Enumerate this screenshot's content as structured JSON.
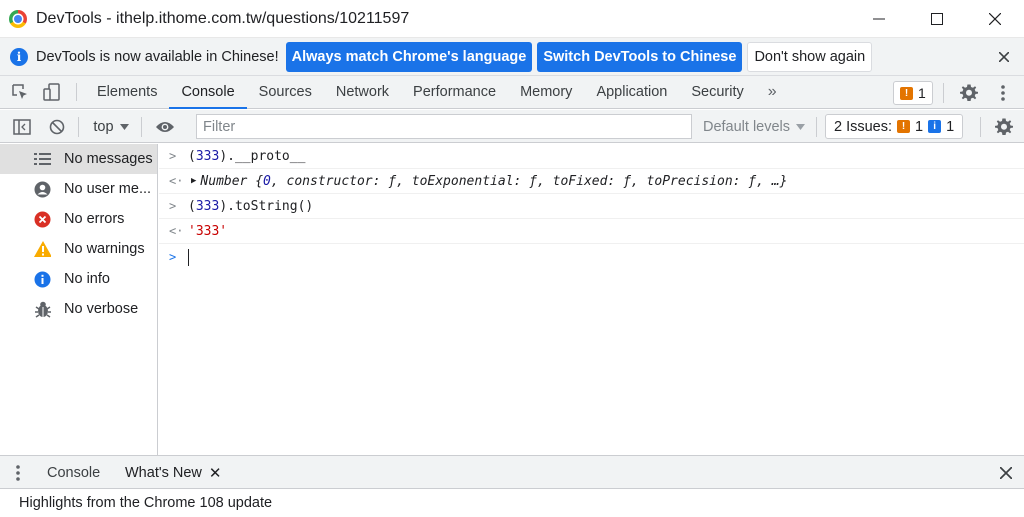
{
  "window": {
    "title": "DevTools - ithelp.ithome.com.tw/questions/10211597",
    "icons": [
      "chrome-logo",
      "minimize-icon",
      "maximize-icon",
      "close-icon"
    ]
  },
  "infobar": {
    "message": "DevTools is now available in Chinese!",
    "btn_match": "Always match Chrome's language",
    "btn_switch": "Switch DevTools to Chinese",
    "btn_dismiss": "Don't show again"
  },
  "tabs": {
    "items": [
      "Elements",
      "Console",
      "Sources",
      "Network",
      "Performance",
      "Memory",
      "Application",
      "Security"
    ],
    "active": "Console",
    "more": "»",
    "issues_count": "1"
  },
  "console_toolbar": {
    "context": "top",
    "filter_placeholder": "Filter",
    "levels": "Default levels",
    "issues_label": "2 Issues:",
    "warn_count": "1",
    "info_count": "1"
  },
  "sidebar": {
    "items": [
      {
        "label": "No messages",
        "icon": "list-icon"
      },
      {
        "label": "No user me...",
        "icon": "user-icon"
      },
      {
        "label": "No errors",
        "icon": "error-icon"
      },
      {
        "label": "No warnings",
        "icon": "warning-icon"
      },
      {
        "label": "No info",
        "icon": "info-icon"
      },
      {
        "label": "No verbose",
        "icon": "bug-icon"
      }
    ]
  },
  "console": {
    "entries": [
      {
        "type": "input",
        "prefix": "(",
        "num": "333",
        "suffix": ").__proto__"
      },
      {
        "type": "output_object",
        "text_a": "Number {",
        "num": "0",
        "text_b": ", constructor: ƒ, toExponential: ƒ, toFixed: ƒ, toPrecision: ƒ, …}"
      },
      {
        "type": "input",
        "prefix": "(",
        "num": "333",
        "suffix": ").toString()"
      },
      {
        "type": "output_string",
        "text": "'333'"
      }
    ]
  },
  "drawer": {
    "tabs": [
      "Console",
      "What's New"
    ],
    "active": "What's New",
    "content": "Highlights from the Chrome 108 update"
  },
  "colors": {
    "accent": "#1a73e8",
    "warning": "#e37400",
    "error": "#d93025",
    "number": "#1a1aa6",
    "string": "#c80000"
  }
}
